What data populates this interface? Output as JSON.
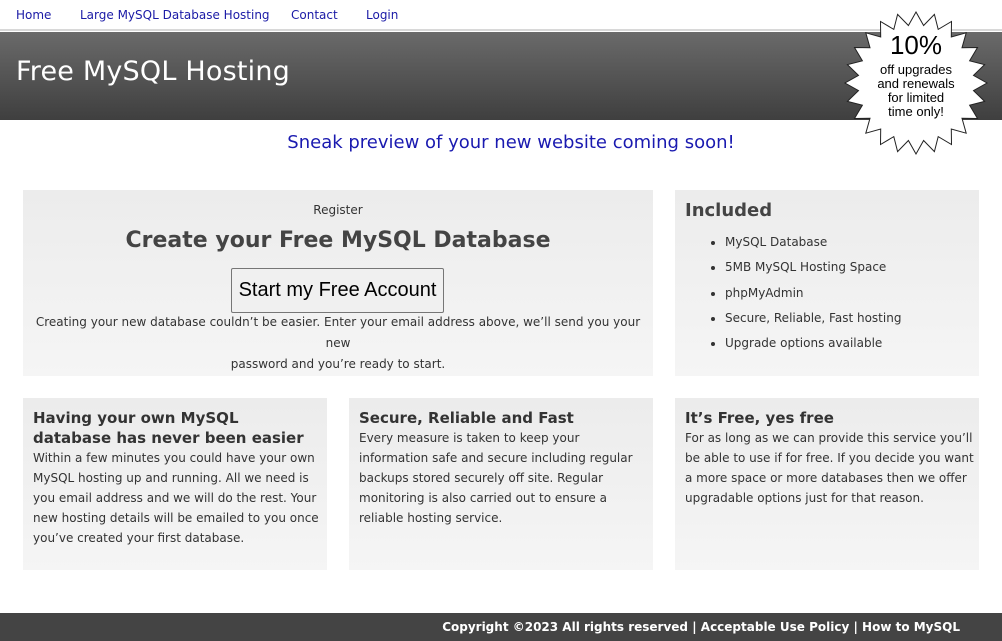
{
  "nav": {
    "home": "Home",
    "large_hosting": "Large MySQL Database Hosting",
    "contact": "Contact",
    "login": "Login"
  },
  "header": {
    "title": "Free MySQL Hosting"
  },
  "badge": {
    "percent": "10%",
    "line1": "off upgrades",
    "line2": "and renewals",
    "line3": "for limited",
    "line4": "time only!"
  },
  "tagline": "Sneak preview of your new website coming soon!",
  "register": {
    "label": "Register",
    "title": "Create your Free MySQL Database",
    "button": "Start my Free Account",
    "desc_line1": "Creating your new database couldn’t be easier. Enter your email address above, we’ll send you your new",
    "desc_line2": "password and you’re ready to start."
  },
  "included": {
    "title": "Included",
    "items": [
      "MySQL Database",
      "5MB MySQL Hosting Space",
      "phpMyAdmin",
      "Secure, Reliable, Fast hosting",
      "Upgrade options available"
    ]
  },
  "features": [
    {
      "title": "Having your own MySQL database has never been easier",
      "text": "Within a few minutes you could have your own MySQL hosting up and running. All we need is you email address and we will do the rest. Your new hosting details will be emailed to you once you’ve created your first database."
    },
    {
      "title": "Secure, Reliable and Fast",
      "text": "Every measure is taken to keep your information safe and secure including regular backups stored securely off site.  Regular monitoring is also carried out to ensure a reliable hosting service."
    },
    {
      "title": "It’s Free, yes free",
      "text": "For as long as we can provide this service you’ll be able to use if for free.  If you decide you want a more space or more databases then we offer upgradable options just for that reason."
    }
  ],
  "footer": {
    "copyright": "Copyright ©2023 All rights reserved",
    "sep1": " | ",
    "aup": "Acceptable Use Policy",
    "sep2": " | ",
    "howto": "How to MySQL"
  },
  "colors": {
    "nav_link": "#1a1aa6",
    "tagline": "#1a1ab0",
    "header_top": "#6a6a6a",
    "header_bottom": "#3f3f3f",
    "footer_bg": "#444444"
  }
}
